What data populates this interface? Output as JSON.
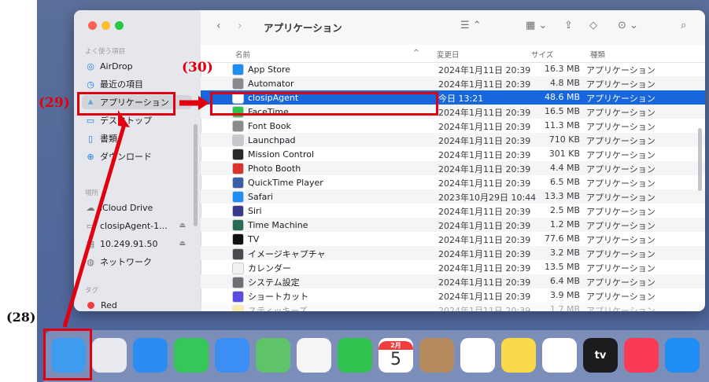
{
  "toolbar": {
    "back_icon": "chevron-left-icon",
    "forward_icon": "chevron-right-icon",
    "title": "アプリケーション"
  },
  "sidebar": {
    "favorites_heading": "よく使う項目",
    "favorites": [
      {
        "label": "AirDrop",
        "icon": "airdrop-icon"
      },
      {
        "label": "最近の項目",
        "icon": "clock-icon"
      },
      {
        "label": "アプリケーション",
        "icon": "applications-icon"
      },
      {
        "label": "デスクトップ",
        "icon": "desktop-icon"
      },
      {
        "label": "書類",
        "icon": "document-icon"
      },
      {
        "label": "ダウンロード",
        "icon": "download-icon"
      }
    ],
    "locations_heading": "場所",
    "locations": [
      {
        "label": "iCloud Drive",
        "icon": "cloud-icon"
      },
      {
        "label": "closipAgent-1...",
        "icon": "disk-icon"
      },
      {
        "label": "10.249.91.50",
        "icon": "server-icon"
      },
      {
        "label": "ネットワーク",
        "icon": "network-icon"
      }
    ],
    "tags_heading": "タグ",
    "tags": [
      {
        "label": "Red",
        "color": "#f33c3c"
      }
    ]
  },
  "columns": {
    "name": "名前",
    "date": "変更日",
    "size": "サイズ",
    "kind": "種類"
  },
  "files": [
    {
      "name": "App Store",
      "date": "2024年1月11日 20:39",
      "size": "16.3 MB",
      "kind": "アプリケーション",
      "color": "#1e8ef5"
    },
    {
      "name": "Automator",
      "date": "2024年1月11日 20:39",
      "size": "4.8 MB",
      "kind": "アプリケーション",
      "color": "#8a8a8e"
    },
    {
      "name": "closipAgent",
      "date": "今日 13:21",
      "size": "48.6 MB",
      "kind": "アプリケーション",
      "color": "#ffffff"
    },
    {
      "name": "FaceTime",
      "date": "2024年1月11日 20:39",
      "size": "16.5 MB",
      "kind": "アプリケーション",
      "color": "#2fc24e"
    },
    {
      "name": "Font Book",
      "date": "2024年1月11日 20:39",
      "size": "11.3 MB",
      "kind": "アプリケーション",
      "color": "#8a8a8e"
    },
    {
      "name": "Launchpad",
      "date": "2024年1月11日 20:39",
      "size": "710 KB",
      "kind": "アプリケーション",
      "color": "#c8c8cc"
    },
    {
      "name": "Mission Control",
      "date": "2024年1月11日 20:39",
      "size": "301 KB",
      "kind": "アプリケーション",
      "color": "#2a2a2e"
    },
    {
      "name": "Photo Booth",
      "date": "2024年1月11日 20:39",
      "size": "4.4 MB",
      "kind": "アプリケーション",
      "color": "#d8342c"
    },
    {
      "name": "QuickTime Player",
      "date": "2024年1月11日 20:39",
      "size": "6.5 MB",
      "kind": "アプリケーション",
      "color": "#3a5ea8"
    },
    {
      "name": "Safari",
      "date": "2023年10月29日 10:44",
      "size": "13.3 MB",
      "kind": "アプリケーション",
      "color": "#1e8ef5"
    },
    {
      "name": "Siri",
      "date": "2024年1月11日 20:39",
      "size": "2.5 MB",
      "kind": "アプリケーション",
      "color": "#3a3a8c"
    },
    {
      "name": "Time Machine",
      "date": "2024年1月11日 20:39",
      "size": "1.2 MB",
      "kind": "アプリケーション",
      "color": "#2a6a52"
    },
    {
      "name": "TV",
      "date": "2024年1月11日 20:39",
      "size": "77.6 MB",
      "kind": "アプリケーション",
      "color": "#111111"
    },
    {
      "name": "イメージキャプチャ",
      "date": "2024年1月11日 20:39",
      "size": "3.2 MB",
      "kind": "アプリケーション",
      "color": "#4a4a4e"
    },
    {
      "name": "カレンダー",
      "date": "2024年1月11日 20:39",
      "size": "13.5 MB",
      "kind": "アプリケーション",
      "color": "#f2f2f2"
    },
    {
      "name": "システム設定",
      "date": "2024年1月11日 20:39",
      "size": "6.4 MB",
      "kind": "アプリケーション",
      "color": "#6e6e73"
    },
    {
      "name": "ショートカット",
      "date": "2024年1月11日 20:39",
      "size": "3.9 MB",
      "kind": "アプリケーション",
      "color": "#5a4ae0"
    },
    {
      "name": "スティッキーズ",
      "date": "2024年1月11日 20:39",
      "size": "1.7 MB",
      "kind": "アプリケーション",
      "color": "#f5d94a"
    }
  ],
  "dock": [
    {
      "name": "Finder",
      "icon": "finder-icon",
      "color": "#3d9cf0"
    },
    {
      "name": "Launchpad",
      "icon": "launchpad-icon",
      "color": "#e8eaf0"
    },
    {
      "name": "Safari",
      "icon": "safari-icon",
      "color": "#2b8df2"
    },
    {
      "name": "Messages",
      "icon": "messages-icon",
      "color": "#35c759"
    },
    {
      "name": "Mail",
      "icon": "mail-icon",
      "color": "#3b8ef3"
    },
    {
      "name": "Maps",
      "icon": "maps-icon",
      "color": "#5fc36a"
    },
    {
      "name": "Photos",
      "icon": "photos-icon",
      "color": "#f5f5f5"
    },
    {
      "name": "FaceTime",
      "icon": "facetime-icon",
      "color": "#2fc24e"
    },
    {
      "name": "Calendar",
      "icon": "calendar-icon",
      "color": "#ffffff",
      "month": "2月",
      "day": "5"
    },
    {
      "name": "Contacts",
      "icon": "contacts-icon",
      "color": "#b48a5e"
    },
    {
      "name": "Reminders",
      "icon": "reminders-icon",
      "color": "#ffffff"
    },
    {
      "name": "Notes",
      "icon": "notes-icon",
      "color": "#f8d94a"
    },
    {
      "name": "Freeform",
      "icon": "freeform-icon",
      "color": "#ffffff"
    },
    {
      "name": "TV",
      "icon": "tv-icon",
      "color": "#1c1c1e",
      "text": "tv"
    },
    {
      "name": "Music",
      "icon": "music-icon",
      "color": "#fa3b56"
    },
    {
      "name": "App Store",
      "icon": "appstore-icon",
      "color": "#1e8ef5"
    }
  ],
  "annotations": {
    "step28": "(28)",
    "step29": "(29)",
    "step30": "(30)",
    "color": "#e0000f"
  }
}
